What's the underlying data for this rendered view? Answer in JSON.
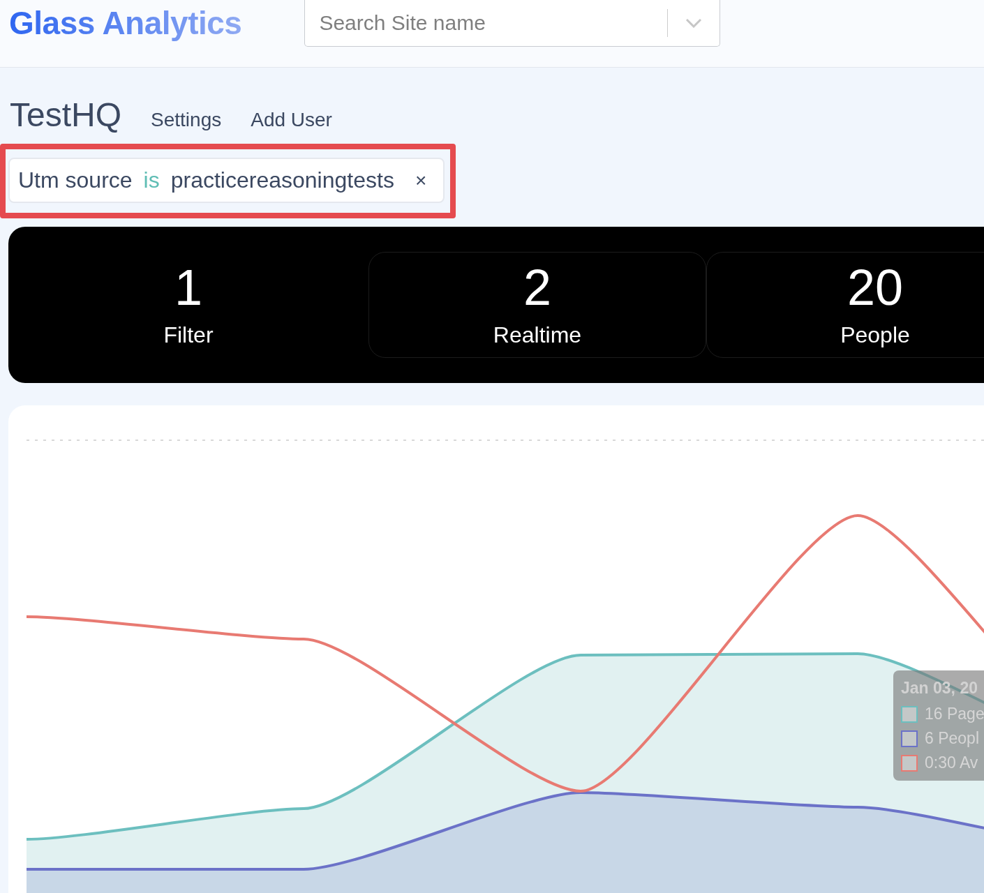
{
  "header": {
    "logo": "Glass Analytics",
    "search": {
      "placeholder": "Search Site name"
    }
  },
  "site": {
    "title": "TestHQ",
    "links": [
      "Settings",
      "Add User"
    ]
  },
  "filters": [
    {
      "field": "Utm source",
      "operator": "is",
      "value": "practicereasoningtests",
      "remove": "×"
    }
  ],
  "stats": [
    {
      "value": "1",
      "label": "Filter"
    },
    {
      "value": "2",
      "label": "Realtime"
    },
    {
      "value": "20",
      "label": "People"
    }
  ],
  "chart": {
    "tooltip": {
      "title": "Jan 03, 20",
      "items": [
        {
          "text": "16 Page",
          "color": "#6cbfbf"
        },
        {
          "text": "6 Peopl",
          "color": "#6b72c8"
        },
        {
          "text": "0:30 Av",
          "color": "#e87a72"
        }
      ]
    }
  }
}
